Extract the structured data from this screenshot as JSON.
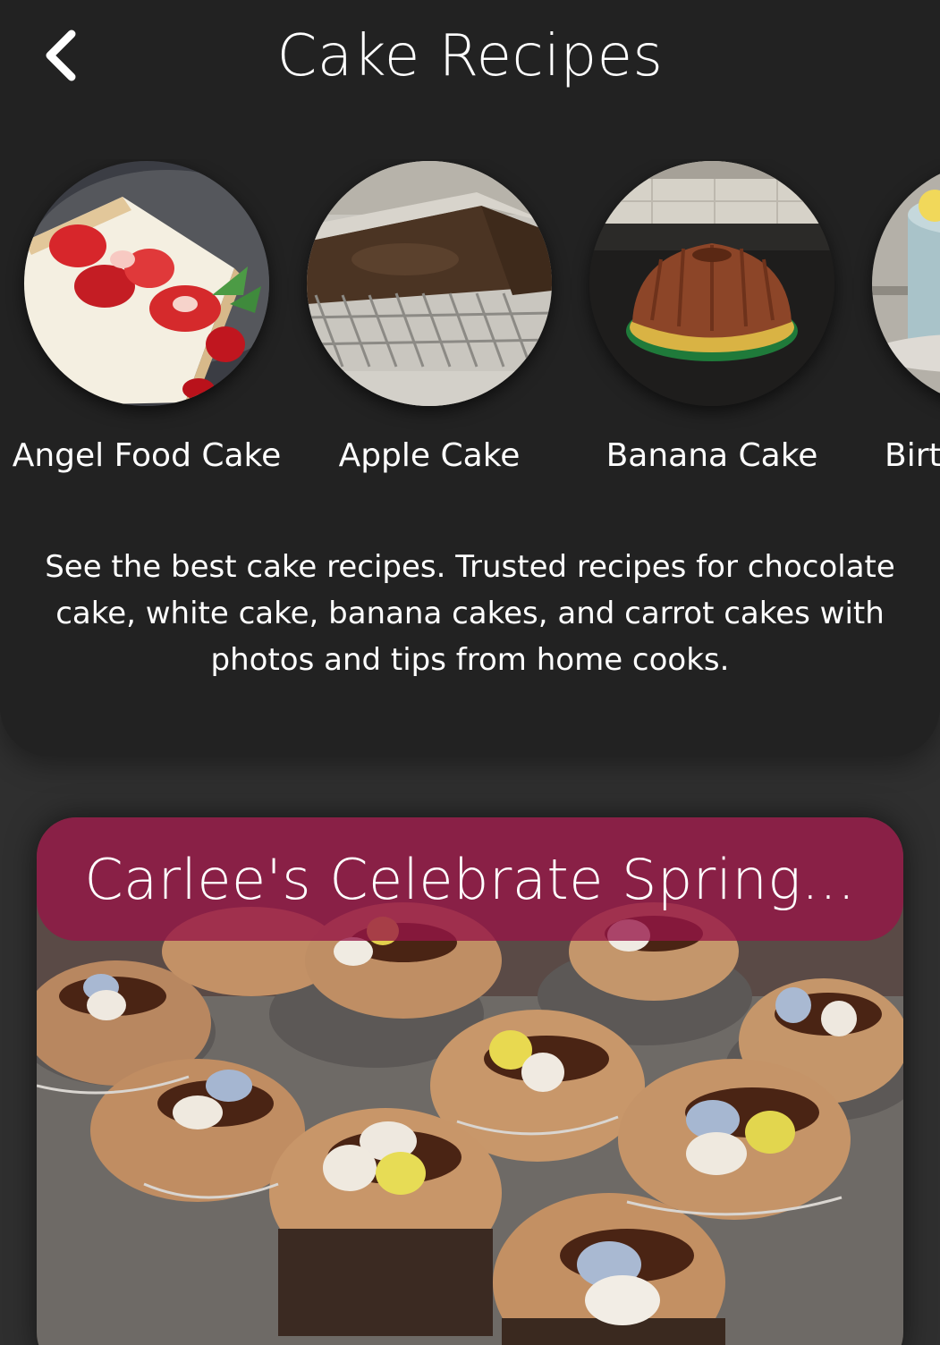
{
  "header": {
    "title": "Cake Recipes",
    "back_icon": "chevron-left-icon"
  },
  "categories": [
    {
      "label": "Angel Food Cake"
    },
    {
      "label": "Apple Cake"
    },
    {
      "label": "Banana Cake"
    },
    {
      "label": "Birt"
    }
  ],
  "description": "See the best cake recipes. Trusted recipes for chocolate cake, white cake, banana cakes, and carrot cakes with photos and tips from home cooks.",
  "featured": {
    "title": "Carlee's Celebrate Spring..."
  },
  "colors": {
    "background": "#2f2f2f",
    "header_panel": "#222222",
    "title_bar": "#96144680",
    "text": "#ffffff"
  }
}
